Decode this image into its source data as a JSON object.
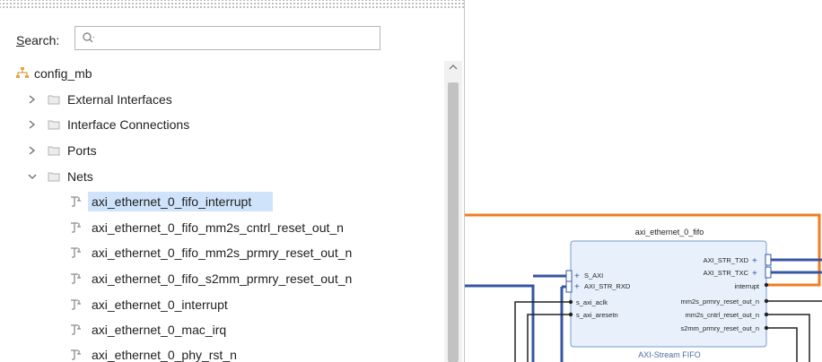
{
  "search": {
    "label_prefix": "S",
    "label_rest": "earch:",
    "placeholder": "Q-"
  },
  "tree": {
    "root": "config_mb",
    "groups": [
      "External Interfaces",
      "Interface Connections",
      "Ports",
      "Nets"
    ],
    "nets": [
      "axi_ethernet_0_fifo_interrupt",
      "axi_ethernet_0_fifo_mm2s_cntrl_reset_out_n",
      "axi_ethernet_0_fifo_mm2s_prmry_reset_out_n",
      "axi_ethernet_0_fifo_s2mm_prmry_reset_out_n",
      "axi_ethernet_0_interrupt",
      "axi_ethernet_0_mac_irq",
      "axi_ethernet_0_phy_rst_n"
    ],
    "selected_net": "axi_ethernet_0_fifo_interrupt"
  },
  "block": {
    "instance_name": "axi_ethernet_0_fifo",
    "type_name": "AXI-Stream FIFO",
    "left_ports": [
      "S_AXI",
      "AXI_STR_RXD",
      "s_axi_aclk",
      "s_axi_aresetn"
    ],
    "right_ports": [
      "AXI_STR_TXD",
      "AXI_STR_TXC",
      "interrupt",
      "mm2s_prmry_reset_out_n",
      "mm2s_cntrl_reset_out_n",
      "s2mm_prmry_reset_out_n"
    ]
  },
  "colors": {
    "selection": "#cfe3fb",
    "highlight_net": "#f07d22",
    "bus": "#3656a4",
    "block_fill": "#e8f1fb",
    "block_border": "#7a9ccc"
  }
}
